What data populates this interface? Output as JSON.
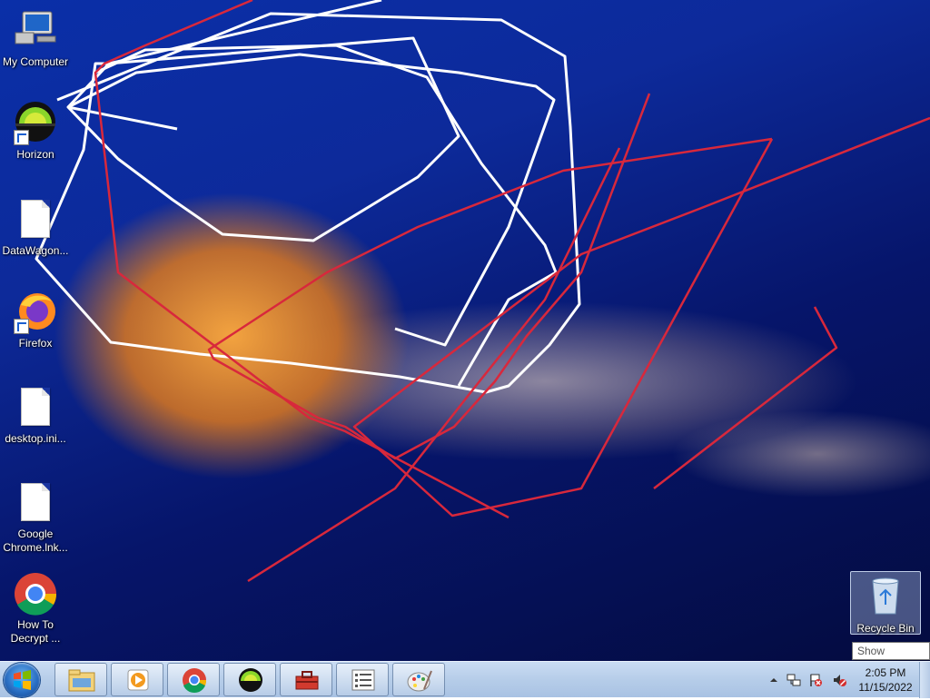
{
  "desktop": {
    "icons": [
      {
        "label": "My Computer",
        "icon": "computer-icon"
      },
      {
        "label": "Horizon",
        "icon": "horizon-icon"
      },
      {
        "label": "DataWagon...",
        "icon": "file-icon"
      },
      {
        "label": "Firefox",
        "icon": "firefox-icon"
      },
      {
        "label": "desktop.ini...",
        "icon": "file-icon"
      },
      {
        "label": "Google Chrome.lnk...",
        "icon": "file-icon"
      },
      {
        "label": "How To Decrypt ...",
        "icon": "chrome-icon"
      }
    ],
    "recycle_bin": {
      "label": "Recycle Bin",
      "icon": "recycle-bin-icon"
    }
  },
  "tooltip": {
    "text": "Show desktop"
  },
  "taskbar": {
    "start": {
      "icon": "windows-start-icon"
    },
    "pinned": [
      {
        "icon": "file-explorer-icon"
      },
      {
        "icon": "media-player-icon"
      },
      {
        "icon": "chrome-icon"
      },
      {
        "icon": "horizon-icon"
      },
      {
        "icon": "toolbox-icon"
      },
      {
        "icon": "checklist-icon"
      },
      {
        "icon": "paint-icon"
      }
    ],
    "tray": {
      "icons": [
        "show-hidden-icons-arrow",
        "network-icon",
        "action-center-flag-icon",
        "volume-muted-icon"
      ]
    },
    "clock": {
      "time": "2:05 PM",
      "date": "11/15/2022"
    }
  },
  "colors": {
    "wallpaper_blue": "#0d2a9a",
    "taskbar": "#b6cde9",
    "doodle_white": "#ffffff",
    "doodle_red": "#d8283c"
  }
}
